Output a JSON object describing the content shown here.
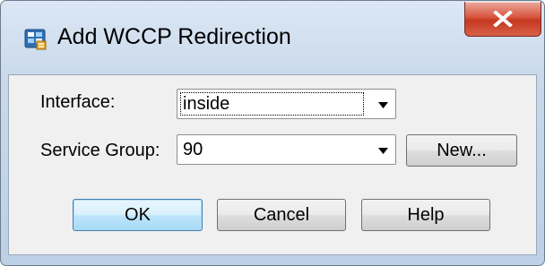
{
  "window": {
    "title": "Add WCCP Redirection",
    "close_icon": "close-icon"
  },
  "form": {
    "interface": {
      "label": "Interface:",
      "value": "inside"
    },
    "service_group": {
      "label": "Service Group:",
      "value": "90",
      "new_button": "New..."
    }
  },
  "buttons": {
    "ok": "OK",
    "cancel": "Cancel",
    "help": "Help"
  },
  "colors": {
    "default_button_border": "#3c7fb1",
    "close_button": "#c5381f"
  }
}
